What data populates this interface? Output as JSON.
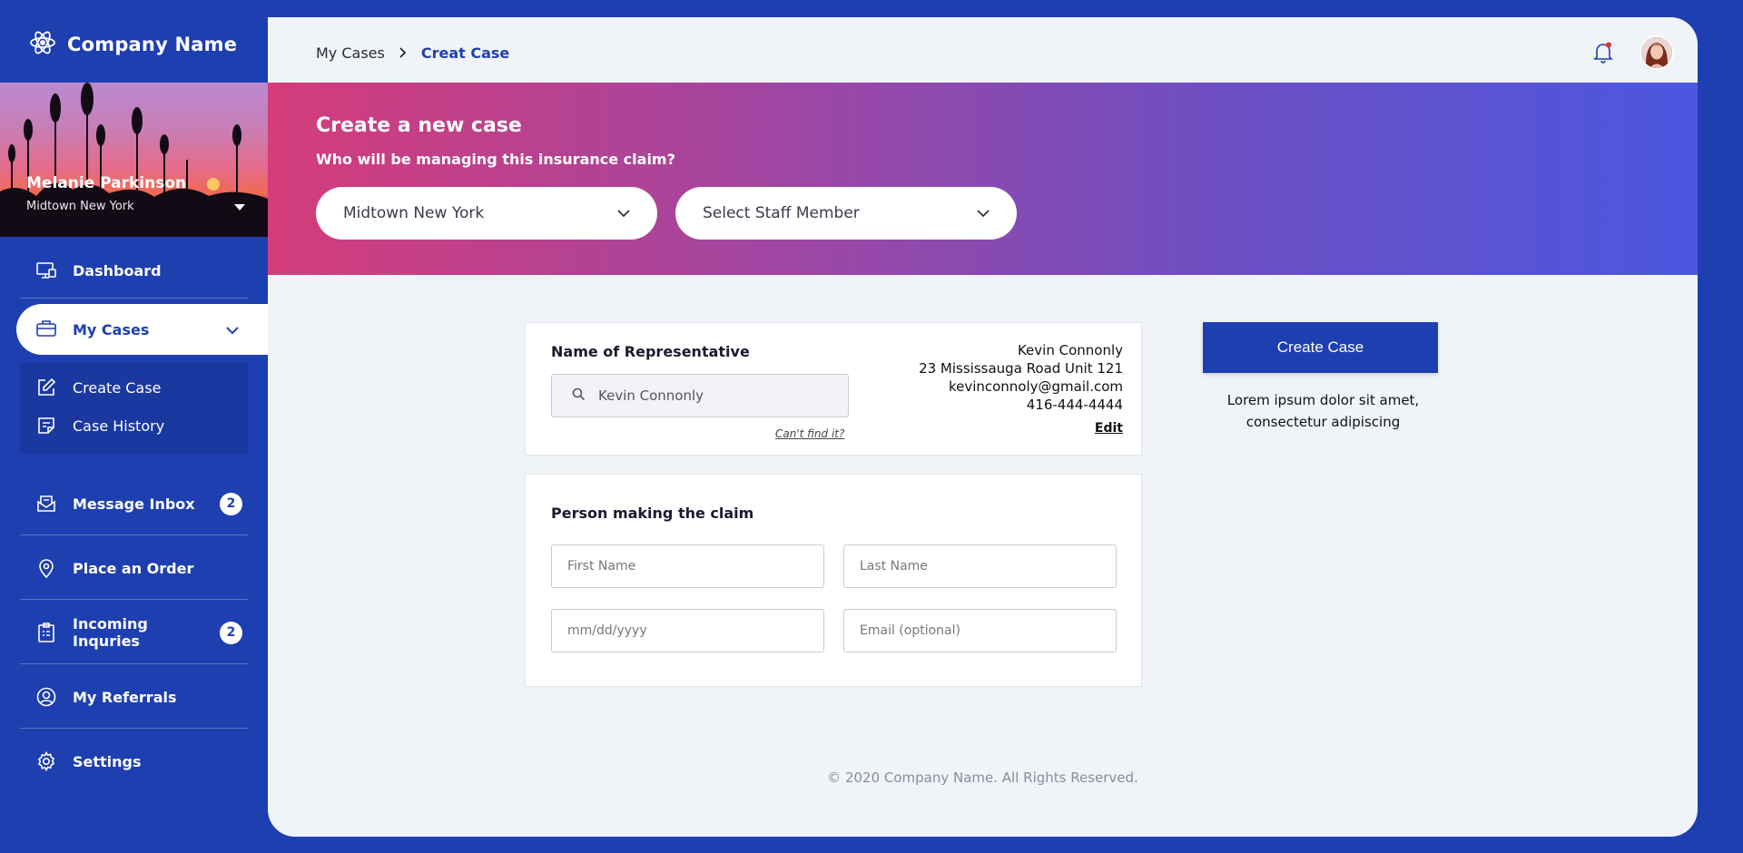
{
  "brand": {
    "name": "Company Name"
  },
  "profile": {
    "name": "Melanie Parkinson",
    "location": "Midtown New York"
  },
  "nav": {
    "dashboard": "Dashboard",
    "my_cases": "My Cases",
    "create_case": "Create Case",
    "case_history": "Case History",
    "message_inbox": "Message Inbox",
    "message_inbox_count": "2",
    "place_order": "Place an Order",
    "incoming_inquiries": "Incoming Inquries",
    "incoming_inquiries_count": "2",
    "my_referrals": "My Referrals",
    "settings": "Settings"
  },
  "breadcrumb": {
    "parent": "My Cases",
    "current": "Creat Case"
  },
  "hero": {
    "title": "Create a new case",
    "subtitle": "Who will be managing this insurance claim?",
    "location_select": "Midtown New York",
    "staff_select": "Select Staff Member"
  },
  "representative": {
    "title": "Name of Representative",
    "search_value": "Kevin Connonly",
    "cant_find": "Can't find it?",
    "name": "Kevin Connonly",
    "address": "23 Mississauga Road Unit 121",
    "email": "kevinconnoly@gmail.com",
    "phone": "416-444-4444",
    "edit": "Edit"
  },
  "claimant": {
    "title": "Person making the claim",
    "first_name_placeholder": "First Name",
    "last_name_placeholder": "Last Name",
    "dob_placeholder": "mm/dd/yyyy",
    "email_placeholder": "Email (optional)"
  },
  "actions": {
    "create_case": "Create Case",
    "note": "Lorem ipsum dolor sit amet, consectetur adipiscing"
  },
  "footer": {
    "copyright": "© 2020 Company Name. All Rights Reserved."
  },
  "colors": {
    "primary": "#1e3fb0",
    "gradient_start": "#d43c7a",
    "gradient_end": "#4b57e0",
    "background": "#f0f3f8"
  },
  "icons": {
    "brand": "atom-icon",
    "dashboard": "monitor-icon",
    "my_cases": "briefcase-icon",
    "create_case": "edit-icon",
    "case_history": "note-icon",
    "message_inbox": "inbox-icon",
    "place_order": "location-pin-icon",
    "incoming_inquiries": "clipboard-icon",
    "my_referrals": "user-circle-icon",
    "settings": "gear-icon",
    "notification": "bell-icon",
    "search": "search-icon"
  }
}
